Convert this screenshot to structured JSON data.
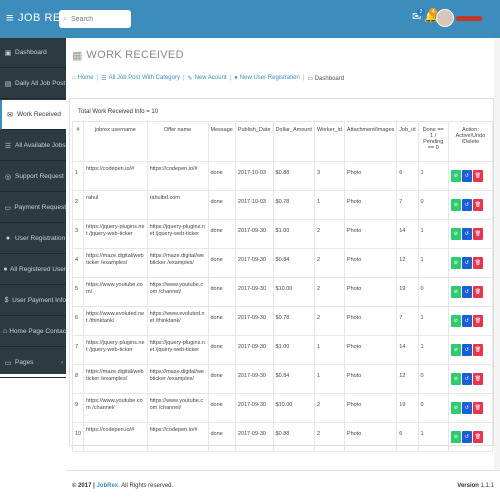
{
  "header": {
    "brand": "JOB REX",
    "search_placeholder": "Search",
    "mail_badge": "2",
    "notif_badge": "4"
  },
  "sidebar": {
    "items": [
      {
        "label": "Dashboard",
        "icon": "dashboard-icon",
        "glyph": "▣"
      },
      {
        "label": "Daily All Job Post",
        "icon": "document-icon",
        "glyph": "▤"
      },
      {
        "label": "Work Received",
        "icon": "inbox-icon",
        "glyph": "✉"
      },
      {
        "label": "All Available Jobs",
        "icon": "list-icon",
        "glyph": "☰"
      },
      {
        "label": "Support Request",
        "icon": "support-icon",
        "glyph": "◎"
      },
      {
        "label": "Payment Request",
        "icon": "card-icon",
        "glyph": "▭"
      },
      {
        "label": "User Registration",
        "icon": "user-icon",
        "glyph": "●"
      },
      {
        "label": "All Registered User",
        "icon": "users-icon",
        "glyph": "●"
      },
      {
        "label": "User Payment Info",
        "icon": "dollar-icon",
        "glyph": "$"
      },
      {
        "label": "Home Page Contact",
        "icon": "home-icon",
        "glyph": "⌂"
      },
      {
        "label": "Pages",
        "icon": "folder-icon",
        "glyph": "▭"
      }
    ]
  },
  "page": {
    "title": "WORK RECEIVED",
    "breadcrumb": [
      "Home",
      "All Job Post With Category",
      "New Acount",
      "New User Registration"
    ],
    "breadcrumb_current": "Dashboard",
    "box_title": "Total Work Received Info = 10"
  },
  "table": {
    "headers": [
      "#",
      "jobrex username",
      "Offer name",
      "Message",
      "Publish_Date",
      "Dollar_Amount",
      "Worker_id",
      "Attachment/Images",
      "Job_id",
      "Done == 1 / Pending == 0",
      "Action: Active/Undo /Delete"
    ],
    "rows": [
      [
        "1",
        "https://codepen.io/#",
        "https://codepen.io/#",
        "done",
        "2017-10-03",
        "$0.88",
        "3",
        "Photo",
        "6",
        "1"
      ],
      [
        "2",
        "rahul",
        "rahulbd.com",
        "done",
        "2017-10-03",
        "$0.78",
        "1",
        "Photo",
        "7",
        "0"
      ],
      [
        "3",
        "https://jquery-plugins.net /jquery-web-ticker",
        "https://jquery-plugins.net /jquery-web-ticker",
        "done",
        "2017-09-30",
        "$1.00",
        "2",
        "Photo",
        "14",
        "1"
      ],
      [
        "4",
        "https://maze.digital/webticker /examples/",
        "https://maze.digital/webticker /examples/",
        "done",
        "2017-09-30",
        "$0.84",
        "2",
        "Photo",
        "12",
        "1"
      ],
      [
        "5",
        "https://www.youtube.com/",
        "https://www.youtube.com /channel/",
        "done",
        "2017-09-30",
        "$10.00",
        "2",
        "Photo",
        "19",
        "0"
      ],
      [
        "6",
        "https://www.evoluted.net /thinktank/",
        "https://www.evoluted.net /thinktank/",
        "done",
        "2017-09-30",
        "$0.78",
        "2",
        "Photo",
        "7",
        "1"
      ],
      [
        "7",
        "https://jquery-plugins.net /jquery-web-ticker",
        "https://jquery-plugins.net /jquery-web-ticker",
        "done",
        "2017-09-30",
        "$1.00",
        "1",
        "Photo",
        "14",
        "1"
      ],
      [
        "8",
        "https://maze.digital/webticker /examples/",
        "https://maze.digital/webticker /examples/",
        "done",
        "2017-09-30",
        "$0.84",
        "1",
        "Photo",
        "12",
        "0"
      ],
      [
        "9",
        "https://www.youtube.com /channel/",
        "https://www.youtube.com /channel/",
        "done",
        "2017-09-30",
        "$10.00",
        "2",
        "Photo",
        "19",
        "0"
      ],
      [
        "10",
        "https://codepen.io/#",
        "https://codepen.io/#",
        "done",
        "2017-09-30",
        "$0.88",
        "2",
        "Photo",
        "6",
        "1"
      ]
    ],
    "action_glyphs": {
      "activate": "⊘",
      "undo": "↺",
      "delete": "🗑"
    }
  },
  "footer": {
    "copyright_prefix": "© 2017 |",
    "brand": "JobRex",
    "copyright_suffix": ". All Rights reserved.",
    "version_label": "Version",
    "version": "1.1.1"
  },
  "colors": {
    "topbar": "#3c8dbc",
    "sidebar": "#2c3b41",
    "btn_active": "#2ecc71",
    "btn_undo": "#1a5fd8",
    "btn_delete": "#e8344e"
  }
}
